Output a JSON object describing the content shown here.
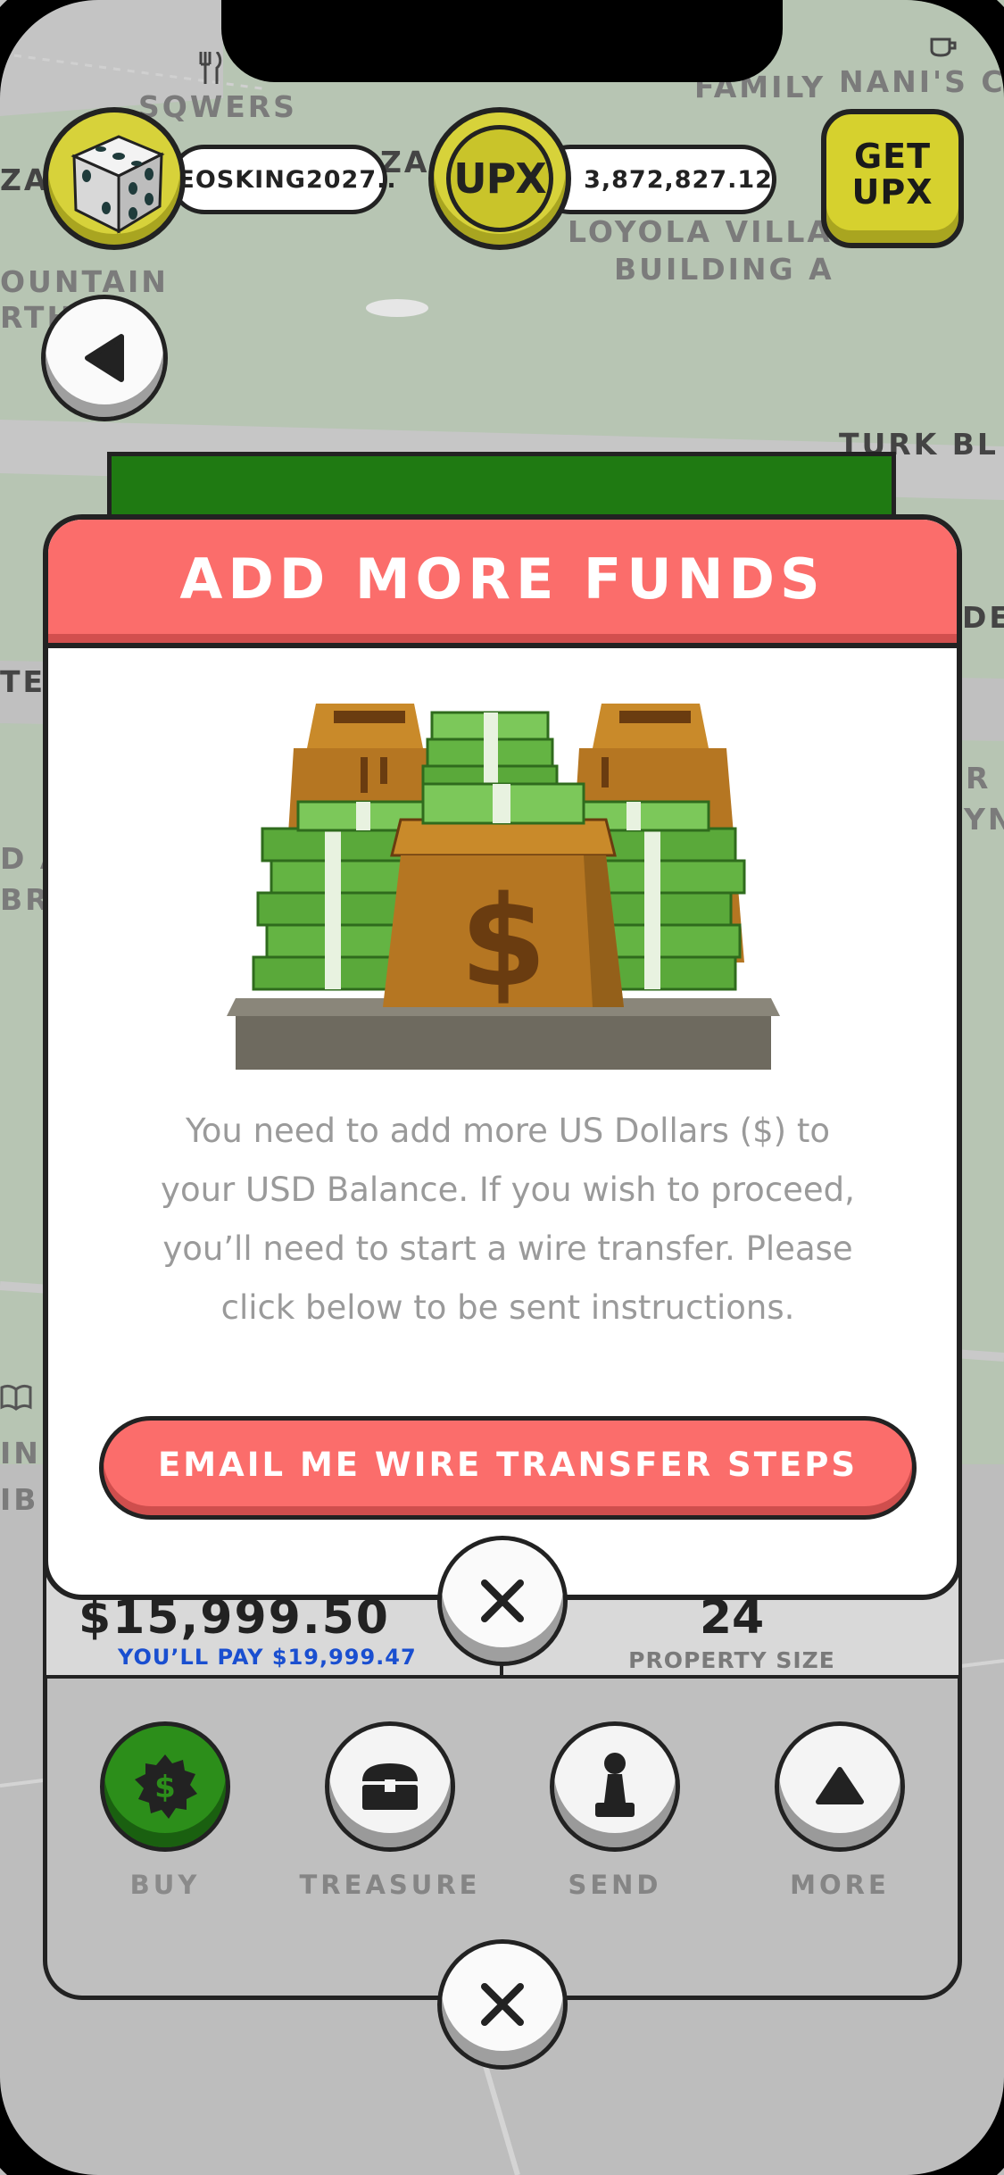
{
  "map": {
    "labels": [
      "SQWERS",
      "FAMILY",
      "NANI'S CA",
      "ZA",
      "ZA",
      "LOYOLA VILLA",
      "BUILDING A",
      "OUNTAIN",
      "RTH",
      "TURK BL",
      "DE",
      "TE",
      "D A",
      "BR",
      "R",
      "YN",
      "IN",
      "IB"
    ]
  },
  "hud": {
    "username": "EOSKING2027..",
    "upx_badge": "UPX",
    "balance": "3,872,827.12",
    "get_upx_line1": "GET",
    "get_upx_line2": "UPX"
  },
  "modal": {
    "title": "ADD MORE FUNDS",
    "message": "You need to add more US Dollars ($) to your USD Balance. If you wish to proceed, you’ll need to start a wire transfer. Please click below to be sent instructions.",
    "cta_label": "EMAIL ME WIRE TRANSFER STEPS"
  },
  "property_panel": {
    "price": "$15,999.50",
    "you_pay": "YOU’LL PAY $19,999.47",
    "size_value": "24",
    "size_label": "PROPERTY SIZE",
    "actions": [
      {
        "label": "BUY",
        "icon": "dollar-badge-icon"
      },
      {
        "label": "TREASURE",
        "icon": "treasure-chest-icon"
      },
      {
        "label": "SEND",
        "icon": "pawn-icon"
      },
      {
        "label": "MORE",
        "icon": "triangle-up-icon"
      }
    ]
  },
  "colors": {
    "accent_red": "#fb6d6b",
    "upx_yellow": "#d6d12e",
    "buy_green": "#2c8e1a",
    "link_blue": "#1a4fd0"
  }
}
